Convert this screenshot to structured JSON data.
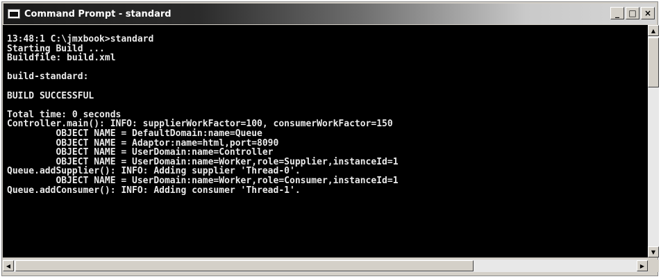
{
  "window": {
    "title": "Command Prompt - standard",
    "icon": "console-icon",
    "controls": {
      "minimize": "_",
      "maximize": "□",
      "close": "×"
    }
  },
  "console": {
    "lines": [
      "13:48:1 C:\\jmxbook>standard",
      "Starting Build ...",
      "Buildfile: build.xml",
      "",
      "build-standard:",
      "",
      "BUILD SUCCESSFUL",
      "",
      "Total time: 0 seconds",
      "Controller.main(): INFO: supplierWorkFactor=100, consumerWorkFactor=150",
      "         OBJECT NAME = DefaultDomain:name=Queue",
      "         OBJECT NAME = Adaptor:name=html,port=8090",
      "         OBJECT NAME = UserDomain:name=Controller",
      "         OBJECT NAME = UserDomain:name=Worker,role=Supplier,instanceId=1",
      "Queue.addSupplier(): INFO: Adding supplier 'Thread-0'.",
      "         OBJECT NAME = UserDomain:name=Worker,role=Consumer,instanceId=1",
      "Queue.addConsumer(): INFO: Adding consumer 'Thread-1'."
    ]
  },
  "scrollbars": {
    "up_arrow": "▲",
    "down_arrow": "▼",
    "left_arrow": "◀",
    "right_arrow": "▶"
  }
}
